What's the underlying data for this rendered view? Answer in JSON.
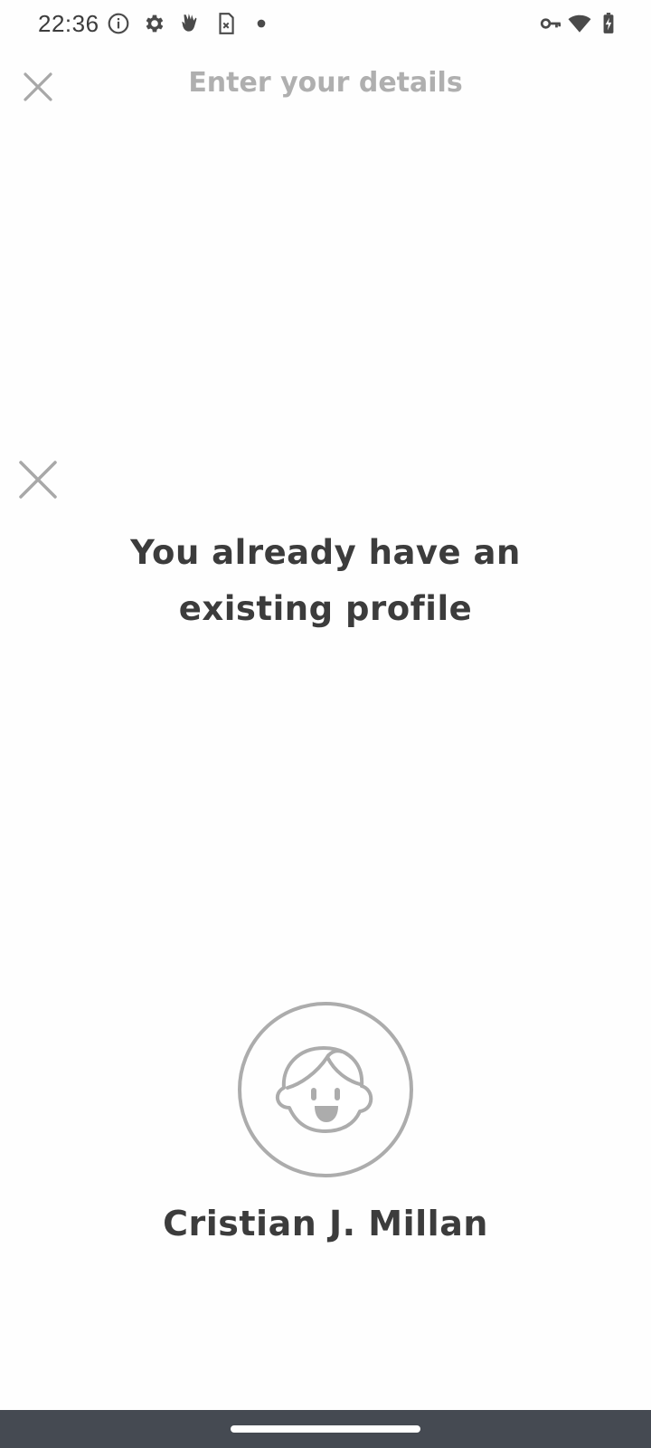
{
  "status_bar": {
    "time": "22:36",
    "left_icons": [
      "info-icon",
      "settings-icon",
      "hand-icon",
      "sim-card-icon",
      "dot-icon"
    ],
    "right_icons": [
      "vpn-key-icon",
      "wifi-icon",
      "battery-charging-icon"
    ]
  },
  "header": {
    "title": "Enter your details",
    "close_icon": "close-icon"
  },
  "dialog": {
    "close_icon": "close-icon",
    "heading": "You already have an existing profile"
  },
  "profile": {
    "avatar_icon": "avatar-face-icon",
    "name": "Cristian J. Millan"
  },
  "colors": {
    "text_dark": "#3c3c3c",
    "text_muted": "#afafaf",
    "icon_gray": "#a8a8a8",
    "nav_bar": "#454a52",
    "background": "#fefefe"
  }
}
